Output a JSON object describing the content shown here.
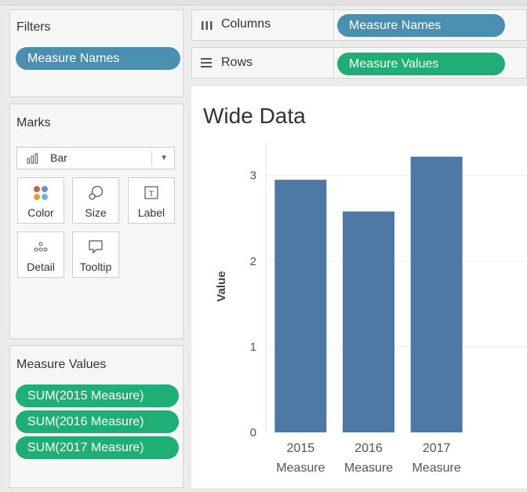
{
  "filters": {
    "title": "Filters",
    "pills": [
      "Measure Names"
    ]
  },
  "marks": {
    "title": "Marks",
    "mark_type": "Bar",
    "buttons": [
      {
        "label": "Color",
        "icon": "color-dots-icon"
      },
      {
        "label": "Size",
        "icon": "size-icon"
      },
      {
        "label": "Label",
        "icon": "label-icon"
      },
      {
        "label": "Detail",
        "icon": "detail-icon"
      },
      {
        "label": "Tooltip",
        "icon": "tooltip-icon"
      }
    ]
  },
  "measure_values": {
    "title": "Measure Values",
    "pills": [
      "SUM(2015 Measure)",
      "SUM(2016 Measure)",
      "SUM(2017 Measure)"
    ]
  },
  "shelves": {
    "columns": {
      "label": "Columns",
      "icon": "columns-icon",
      "pill": "Measure Names"
    },
    "rows": {
      "label": "Rows",
      "icon": "rows-icon",
      "pill": "Measure Values"
    }
  },
  "colors": {
    "blue_pill": "#4a8fb0",
    "green_pill": "#1fae76",
    "bar": "#4e79a7"
  },
  "chart_data": {
    "type": "bar",
    "title": "Wide Data",
    "ylabel": "Value",
    "xlabel": "",
    "categories": [
      [
        "2015",
        "Measure"
      ],
      [
        "2016",
        "Measure"
      ],
      [
        "2017",
        "Measure"
      ]
    ],
    "values": [
      2.95,
      2.58,
      3.22
    ],
    "ylim": [
      0,
      3.4
    ],
    "yticks": [
      "0",
      "1",
      "2",
      "3"
    ],
    "gridlines": true,
    "bar_color": "#4e79a7"
  }
}
